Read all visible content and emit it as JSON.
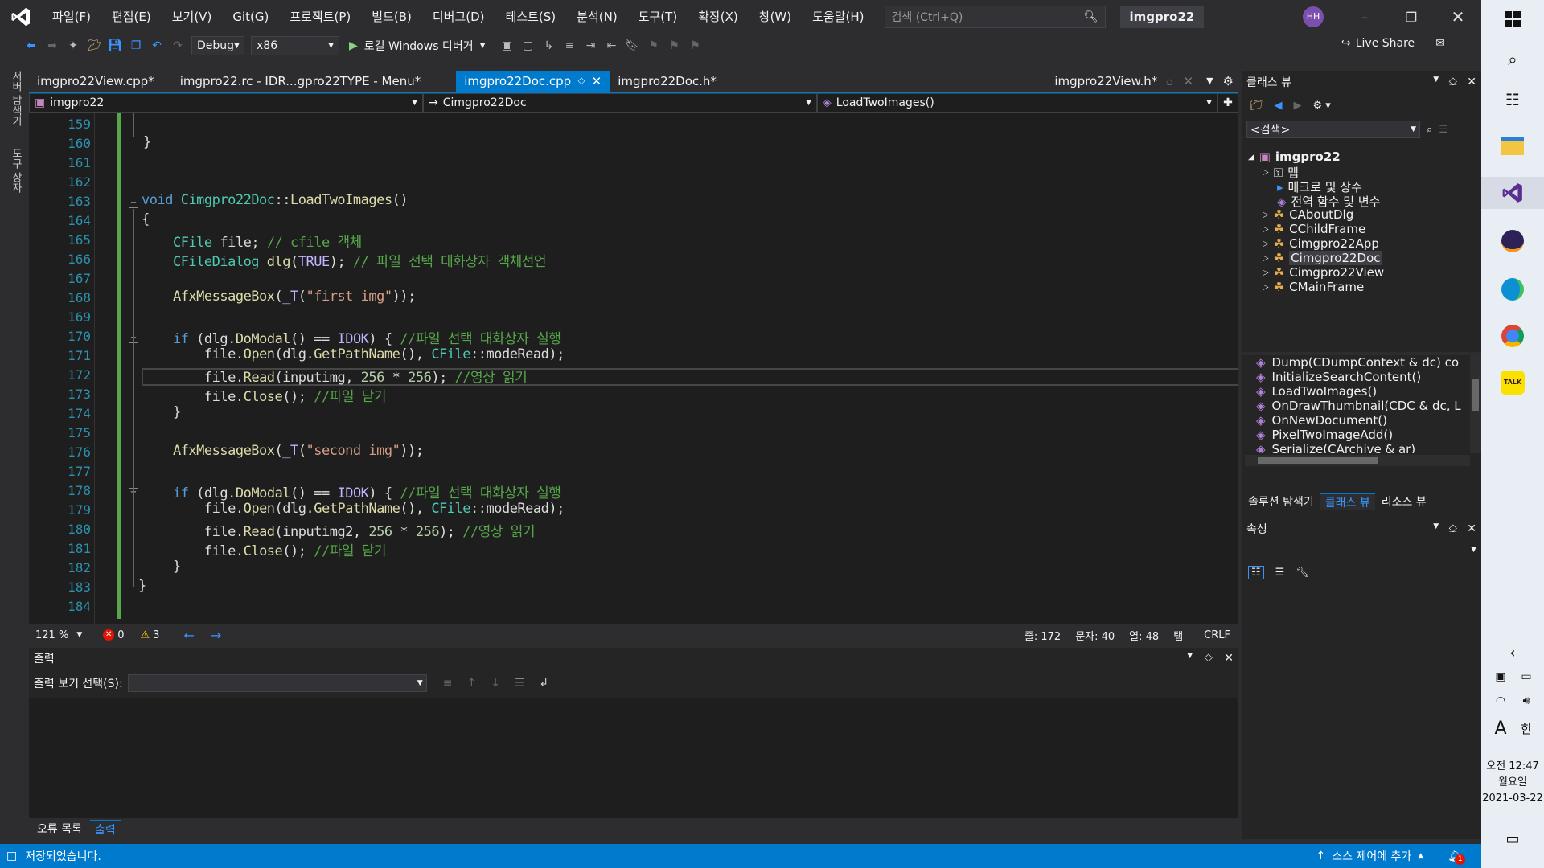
{
  "menubar": {
    "items": [
      "파일(F)",
      "편집(E)",
      "보기(V)",
      "Git(G)",
      "프로젝트(P)",
      "빌드(B)",
      "디버그(D)",
      "테스트(S)",
      "분석(N)",
      "도구(T)",
      "확장(X)",
      "창(W)",
      "도움말(H)"
    ],
    "search_placeholder": "검색 (Ctrl+Q)",
    "solution_name": "imgpro22",
    "avatar_initials": "HH"
  },
  "toolbar": {
    "config": "Debug",
    "platform": "x86",
    "run_label": "로컬 Windows 디버거",
    "live_share": "Live Share"
  },
  "left_strip": {
    "server_explorer": "서버 탐색기",
    "toolbox": "도구 상자"
  },
  "tabs": [
    {
      "label": "imgpro22View.cpp*"
    },
    {
      "label": "imgpro22.rc - IDR...gpro22TYPE - Menu*"
    },
    {
      "label": "imgpro22Doc.cpp",
      "active": true
    },
    {
      "label": "imgpro22Doc.h*"
    }
  ],
  "right_tab": "imgpro22View.h*",
  "navbar": {
    "project": "imgpro22",
    "class": "Cimgpro22Doc",
    "member": "LoadTwoImages()"
  },
  "editor": {
    "line_numbers": [
      "159",
      "160",
      "161",
      "162",
      "163",
      "164",
      "165",
      "166",
      "167",
      "168",
      "169",
      "170",
      "171",
      "172",
      "173",
      "174",
      "175",
      "176",
      "177",
      "178",
      "179",
      "180",
      "181",
      "182",
      "183",
      "184"
    ],
    "zoom": "121 %",
    "errors": "0",
    "warnings": "3",
    "position": {
      "line": "줄: 172",
      "char": "문자: 40",
      "col": "열: 48",
      "tab": "탭",
      "eol": "CRLF"
    }
  },
  "output": {
    "title": "출력",
    "select_label": "출력 보기 선택(S):",
    "bottom_tabs": [
      "오류 목록",
      "출력"
    ]
  },
  "class_view": {
    "title": "클래스 뷰",
    "search_placeholder": "<검색>",
    "root": "imgpro22",
    "nodes": [
      "맵",
      "매크로 및 상수",
      "전역 함수 및 변수",
      "CAboutDlg",
      "CChildFrame",
      "Cimgpro22App",
      "Cimgpro22Doc",
      "Cimgpro22View",
      "CMainFrame"
    ],
    "members": [
      "Dump(CDumpContext & dc) co",
      "InitializeSearchContent()",
      "LoadTwoImages()",
      "OnDrawThumbnail(CDC & dc, L",
      "OnNewDocument()",
      "PixelTwoImageAdd()",
      "Serialize(CArchive & ar)"
    ],
    "bottom_tabs": [
      "솔루션 탐색기",
      "클래스 뷰",
      "리소스 뷰"
    ]
  },
  "properties": {
    "title": "속성"
  },
  "statusbar": {
    "message": "저장되었습니다.",
    "source_control": "소스 제어에 추가",
    "notif_count": "1"
  },
  "taskbar": {
    "time": "오전 12:47",
    "day": "월요일",
    "date": "2021-03-22",
    "ime": "한",
    "font_a": "A",
    "kakao": "TALK"
  },
  "colors": {
    "accent": "#007acc",
    "keyword": "#569cd6",
    "comment": "#57a64a",
    "string": "#d69d85",
    "class": "#4ec9b0"
  }
}
